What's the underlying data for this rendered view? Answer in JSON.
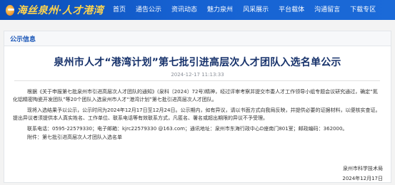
{
  "header": {
    "logo_text": "海丝泉州·人才港湾",
    "nav_items": [
      {
        "label": "首页"
      },
      {
        "label": "通告公示"
      },
      {
        "label": "资讯动态"
      },
      {
        "label": "魅力泉州"
      },
      {
        "label": "风采展示"
      },
      {
        "label": "平台载体"
      },
      {
        "label": "沟通留言"
      },
      {
        "label": "下载专区"
      }
    ]
  },
  "section": {
    "title": "公示信息"
  },
  "article": {
    "title": "泉州市人才“港湾计划”第七批引进高层次人才团队入选名单公示",
    "date": "2024-12-17 11:13:33",
    "paragraphs": [
      "根据《关于申报第七批泉州市引进高层次人才团队的通知》(泉科〔2024〕72号)精神，经过评审考察并提交市委人才工作领导小组专题会议研究通过，确定“氮化铝精密陶瓷开发团队”等20个团队入选泉州市人才“港湾计划”第七批引进高层次人才团队。",
      "现将入选结果予以公示，公示时间为2024年12月17日至12月24日。公示期内，如有异议，请以书面方式向我局反映，并提供必要的证据材料，以便核实查证。提出异议者须提供本人真实姓名、工作单位、联系电话等有效联系方式，凡匿名、署名或超出期限的异议不予受理。",
      "联系电话：0595-22579330；电子邮箱：kjrc22579330 @163.com；通讯地址：泉州市东海行政中心D座南门801室；邮政编码：362000。",
      "附件：第七批引进高层次人才团队入选名单"
    ],
    "signature_org": "泉州市科学技术局",
    "signature_date": "2024年12月17日"
  }
}
